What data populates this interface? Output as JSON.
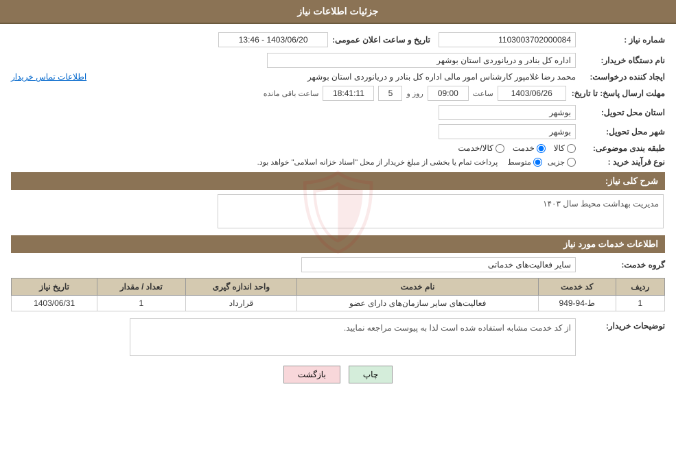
{
  "header": {
    "title": "جزئیات اطلاعات نیاز"
  },
  "fields": {
    "need_number_label": "شماره نیاز :",
    "need_number_value": "1103003702000084",
    "announce_date_label": "تاریخ و ساعت اعلان عمومی:",
    "announce_date_value": "1403/06/20 - 13:46",
    "buyer_org_label": "نام دستگاه خریدار:",
    "buyer_org_value": "اداره کل بنادر و دریانوردی استان بوشهر",
    "creator_label": "ایجاد کننده درخواست:",
    "creator_value": "محمد رضا غلامپور کارشناس امور مالی اداره کل بنادر و دریانوردی استان بوشهر",
    "contact_info_link": "اطلاعات تماس خریدار",
    "reply_deadline_label": "مهلت ارسال پاسخ: تا تاریخ:",
    "reply_date_value": "1403/06/26",
    "reply_time_label": "ساعت",
    "reply_time_value": "09:00",
    "reply_days_label": "روز و",
    "reply_days_value": "5",
    "remaining_time_label": "ساعت باقی مانده",
    "remaining_time_value": "18:41:11",
    "province_label": "استان محل تحویل:",
    "province_value": "بوشهر",
    "city_label": "شهر محل تحویل:",
    "city_value": "بوشهر",
    "category_label": "طبقه بندی موضوعی:",
    "category_goods": "کالا",
    "category_service": "خدمت",
    "category_goods_service": "کالا/خدمت",
    "category_selected": "service",
    "process_type_label": "نوع فرآیند خرید :",
    "process_part": "جزیی",
    "process_medium": "متوسط",
    "process_note": "پرداخت تمام یا بخشی از مبلغ خریدار از محل \"اسناد خزانه اسلامی\" خواهد بود.",
    "process_selected": "medium",
    "general_description_label": "شرح کلی نیاز:",
    "general_description_value": "مدیریت بهداشت محیط سال ۱۴۰۳",
    "services_info_label": "اطلاعات خدمات مورد نیاز",
    "service_group_label": "گروه خدمت:",
    "service_group_value": "سایر فعالیت‌های خدماتی",
    "table": {
      "headers": [
        "ردیف",
        "کد خدمت",
        "نام خدمت",
        "واحد اندازه گیری",
        "تعداد / مقدار",
        "تاریخ نیاز"
      ],
      "rows": [
        {
          "row": "1",
          "service_code": "ط-94-949",
          "service_name": "فعالیت‌های سایر سازمان‌های دارای عضو",
          "unit": "قرارداد",
          "quantity": "1",
          "date": "1403/06/31"
        }
      ]
    },
    "buyer_notes_label": "توضیحات خریدار:",
    "buyer_notes_value": "از کد خدمت مشابه استفاده شده است لذا به پیوست مراجعه نمایید.",
    "btn_print": "چاپ",
    "btn_back": "بازگشت"
  }
}
